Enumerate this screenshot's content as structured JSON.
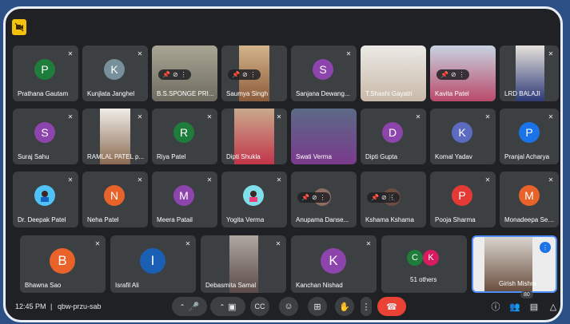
{
  "participants": {
    "prathana": "Prathana Gautam",
    "kunjlata": "Kunjlata Janghel",
    "bssponge": "B.S.SPONGE PRI...",
    "saumya": "Saumya Singh",
    "sanjana": "Sanjana Dewang...",
    "tshashi": "T.Shashi Gayatri",
    "kavita": "Kavita Patel",
    "lrd": "LRD BALAJI",
    "suraj": "Suraj Sahu",
    "ramlal": "RAMLAL PATEL p...",
    "riya": "Riya Patel",
    "dipti_shukla": "Dipti Shukla",
    "swati": "Swati Verma",
    "dipti_gupta": "Dipti Gupta",
    "komal": "Komal Yadav",
    "pranjal": "Pranjal Acharya",
    "deepak": "Dr. Deepak Patel",
    "neha": "Neha Patel",
    "meera": "Meera Patail",
    "yogita": "Yogita Verma",
    "anupama": "Anupama Danse...",
    "kshama": "Kshama Kshama",
    "pooja": "Pooja Sharma",
    "monadeepa": "Monadeepa Sen...",
    "bhawna": "Bhawna Sao",
    "israfil": "Israfil Ali",
    "debasmita": "Debasmita Samal",
    "kanchan": "Kanchan Nishad",
    "others": "51 others",
    "girish": "Girish Mishra"
  },
  "initials": {
    "P": "P",
    "K": "K",
    "S": "S",
    "R": "R",
    "D": "D",
    "N": "N",
    "M": "M",
    "B": "B",
    "I": "I",
    "C": "C"
  },
  "meeting": {
    "time": "12:45 PM",
    "separator": "|",
    "code": "qbw-przu-sab",
    "participant_count": "80"
  },
  "colors": {
    "brand_border": "#2c4f86",
    "tile_bg": "#3c4043",
    "end_call": "#ea4335",
    "green": "#1e7d3a",
    "indigo": "#5c6bc0",
    "purple": "#8e44ad",
    "orange": "#e8622a",
    "blue": "#1a73e8"
  }
}
